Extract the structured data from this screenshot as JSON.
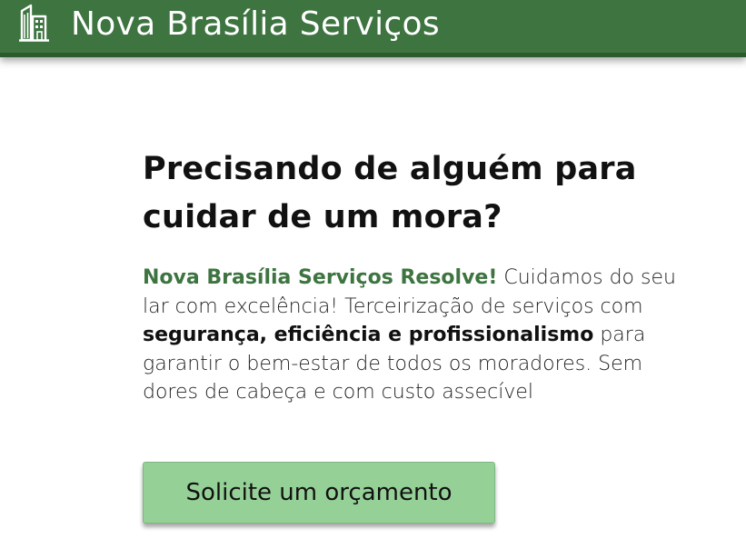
{
  "header": {
    "brand": "Nova Brasília Serviços",
    "logo_icon": "building-icon",
    "background_color": "#3d7440"
  },
  "hero": {
    "headline": "Precisando de alguém para cuidar de um mora?",
    "intro_brand": "Nova Brasília Serviços Resolve!",
    "intro_text_1": " Cuidamos do seu lar com excelência! Terceirização de serviços com ",
    "intro_strong": "segurança, eficiência e profissionalismo",
    "intro_text_2": " para garantir o bem-estar de todos os moradores. Sem dores de cabeça e com custo assecível"
  },
  "cta": {
    "label": "Solicite um orçamento",
    "color": "#95d197"
  }
}
